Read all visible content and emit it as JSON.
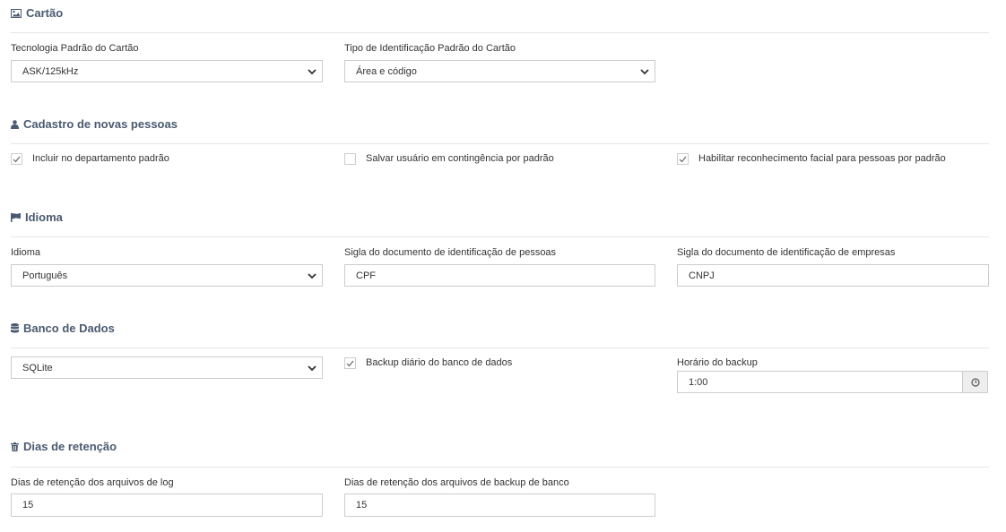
{
  "cartao": {
    "title": "Cartão",
    "tecnologia_label": "Tecnologia Padrão do Cartão",
    "tecnologia_value": "ASK/125kHz",
    "tipo_label": "Tipo de Identificação Padrão do Cartão",
    "tipo_value": "Área e código"
  },
  "cadastro": {
    "title": "Cadastro de novas pessoas",
    "options": [
      {
        "label": "Incluir no departamento padrão",
        "checked": true
      },
      {
        "label": "Salvar usuário em contingência por padrão",
        "checked": false
      },
      {
        "label": "Habilitar reconhecimento facial para pessoas por padrão",
        "checked": true
      }
    ]
  },
  "idioma": {
    "title": "Idioma",
    "idioma_label": "Idioma",
    "idioma_value": "Português",
    "sigla_pessoas_label": "Sigla do documento de identificação de pessoas",
    "sigla_pessoas_value": "CPF",
    "sigla_empresas_label": "Sigla do documento de identificação de empresas",
    "sigla_empresas_value": "CNPJ"
  },
  "banco": {
    "title": "Banco de Dados",
    "db_value": "SQLite",
    "backup_label": "Backup diário do banco de dados",
    "backup_checked": true,
    "horario_label": "Horário do backup",
    "horario_value": "1:00"
  },
  "retencao": {
    "title": "Dias de retenção",
    "log_label": "Dias de retenção dos arquivos de log",
    "log_value": "15",
    "backup_label": "Dias de retenção dos arquivos de backup de banco",
    "backup_value": "15"
  },
  "colors": {
    "section_title": "#4a5a70",
    "border": "#cccccc",
    "divider": "#e6e6e6"
  }
}
